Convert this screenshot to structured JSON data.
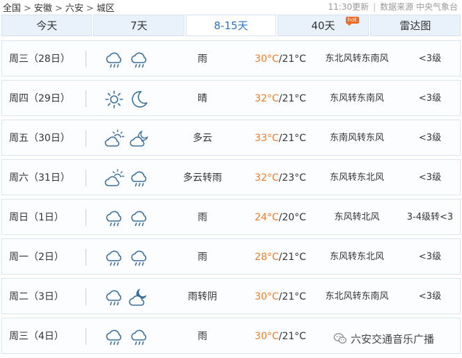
{
  "breadcrumb": {
    "items": [
      "全国",
      "安徽",
      "六安",
      "城区"
    ],
    "separator": ">"
  },
  "meta": {
    "update_time": "11:30更新",
    "source": "数据来源 中央气象台"
  },
  "tabs": [
    {
      "label": "今天",
      "active": false,
      "badge": ""
    },
    {
      "label": "7天",
      "active": false,
      "badge": ""
    },
    {
      "label": "8-15天",
      "active": true,
      "badge": ""
    },
    {
      "label": "40天",
      "active": false,
      "badge": "hot"
    },
    {
      "label": "雷达图",
      "active": false,
      "badge": ""
    }
  ],
  "forecast": [
    {
      "day": "周三（28日）",
      "icons": [
        "rain-cloud-icon",
        "rain-cloud-icon"
      ],
      "weather": "雨",
      "high": "30°C",
      "low": "/21°C",
      "wind": "东北风转东南风",
      "level": "<3级"
    },
    {
      "day": "周四（29日）",
      "icons": [
        "sun-icon",
        "moon-icon"
      ],
      "weather": "晴",
      "high": "32°C",
      "low": "/21°C",
      "wind": "东风转东南风",
      "level": "<3级"
    },
    {
      "day": "周五（30日）",
      "icons": [
        "partly-cloudy-day-icon",
        "partly-cloudy-night-icon"
      ],
      "weather": "多云",
      "high": "33°C",
      "low": "/21°C",
      "wind": "东南风转东风",
      "level": "<3级"
    },
    {
      "day": "周六（31日）",
      "icons": [
        "partly-cloudy-day-icon",
        "rain-cloud-icon"
      ],
      "weather": "多云转雨",
      "high": "32°C",
      "low": "/23°C",
      "wind": "东风转东北风",
      "level": "<3级"
    },
    {
      "day": "周日（1日）",
      "icons": [
        "rain-cloud-icon",
        "rain-cloud-icon"
      ],
      "weather": "雨",
      "high": "24°C",
      "low": "/20°C",
      "wind": "东风转北风",
      "level": "3-4级转<3"
    },
    {
      "day": "周一（2日）",
      "icons": [
        "rain-cloud-icon",
        "rain-cloud-icon"
      ],
      "weather": "雨",
      "high": "28°C",
      "low": "/21°C",
      "wind": "东风转东北风",
      "level": "<3级"
    },
    {
      "day": "周二（3日）",
      "icons": [
        "rain-cloud-icon",
        "cloudy-night-icon"
      ],
      "weather": "雨转阴",
      "high": "30°C",
      "low": "/21°C",
      "wind": "东北风转东南风",
      "level": "<3级"
    },
    {
      "day": "周三（4日）",
      "icons": [
        "rain-cloud-icon",
        "rain-cloud-icon"
      ],
      "weather": "雨",
      "high": "30°C",
      "low": "/21°C",
      "wind": "",
      "level": ""
    }
  ],
  "watermark": {
    "text": "六安交通音乐广播",
    "icon": "wechat-icon"
  },
  "colors": {
    "accent": "#2a72c5",
    "temp_high": "#f07b26",
    "icon_stroke": "#3a6f9c",
    "tab_bg": "#e9f2fb",
    "hot_badge": "#f46c22"
  }
}
